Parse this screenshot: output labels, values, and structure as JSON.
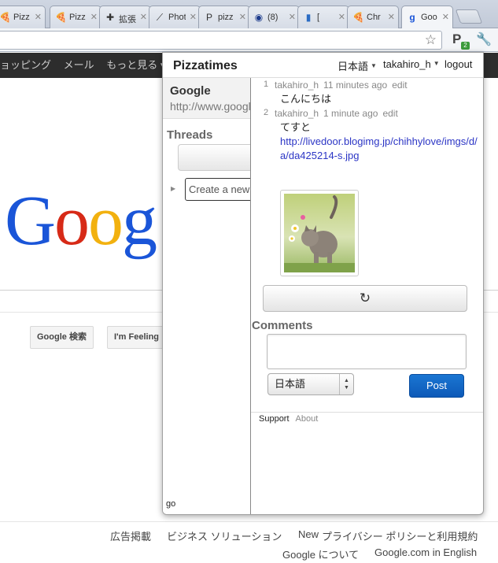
{
  "tabs": [
    {
      "icon": "pizza-icon",
      "glyph": "🍕",
      "title": "Pizz"
    },
    {
      "icon": "pizza-icon",
      "glyph": "🍕",
      "title": "Pizz"
    },
    {
      "icon": "puzzle-icon",
      "glyph": "✚",
      "title": "拡張"
    },
    {
      "icon": "brush-icon",
      "glyph": "⟋",
      "title": "Phot"
    },
    {
      "icon": "p-logo-icon",
      "glyph": "P",
      "title": "pizz"
    },
    {
      "icon": "disc-icon",
      "glyph": "◉",
      "title": "(8)"
    },
    {
      "icon": "docs-icon",
      "glyph": "▮",
      "title": "["
    },
    {
      "icon": "pizza-icon",
      "glyph": "🍕",
      "title": "Chr"
    },
    {
      "icon": "google-icon",
      "glyph": "g",
      "title": "Goo"
    }
  ],
  "toolbar": {
    "extension_badge": "2"
  },
  "google_page": {
    "nav_items": [
      "ョッピング",
      "メール",
      "もっと見る ▾"
    ],
    "logo": [
      "G",
      "o",
      "o",
      "g"
    ],
    "search_button": "Google 検索",
    "lucky_button": "I'm Feeling",
    "footer_row1": {
      "ads": "広告掲載",
      "business": "ビジネス ソリューション",
      "new_badge": "New",
      "privacy": "プライバシー ポリシーと利用規約"
    },
    "footer_row2": {
      "about": "Google について",
      "english": "Google.com in English"
    }
  },
  "popup": {
    "brand": "Pizzatimes",
    "language": "日本語",
    "user": "takahiro_h",
    "logout": "logout",
    "site": {
      "name": "Google",
      "url": "http://www.google.co.jp/"
    },
    "threads_heading": "Threads",
    "create_placeholder": "Create a new thread",
    "sidebar_footer": "go",
    "messages": [
      {
        "no": "1",
        "author": "takahiro_h",
        "time": "11 minutes ago",
        "edit": "edit",
        "text": "こんにちは"
      },
      {
        "no": "2",
        "author": "takahiro_h",
        "time": "1 minute ago",
        "edit": "edit",
        "text": "てすと",
        "link": "http://livedoor.blogimg.jp/chihhylove/imgs/d/a/da425214-s.jpg"
      }
    ],
    "reload_icon": "↻",
    "comments_heading": "Comments",
    "comment_language": "日本語",
    "post_button": "Post",
    "footer": {
      "support": "Support",
      "about": "About"
    }
  },
  "colors": {
    "accent": "#1a76d2",
    "link": "#2b35c5",
    "google_blue": "#1a55d8",
    "google_red": "#d72a17",
    "google_yellow": "#f2b10f"
  }
}
